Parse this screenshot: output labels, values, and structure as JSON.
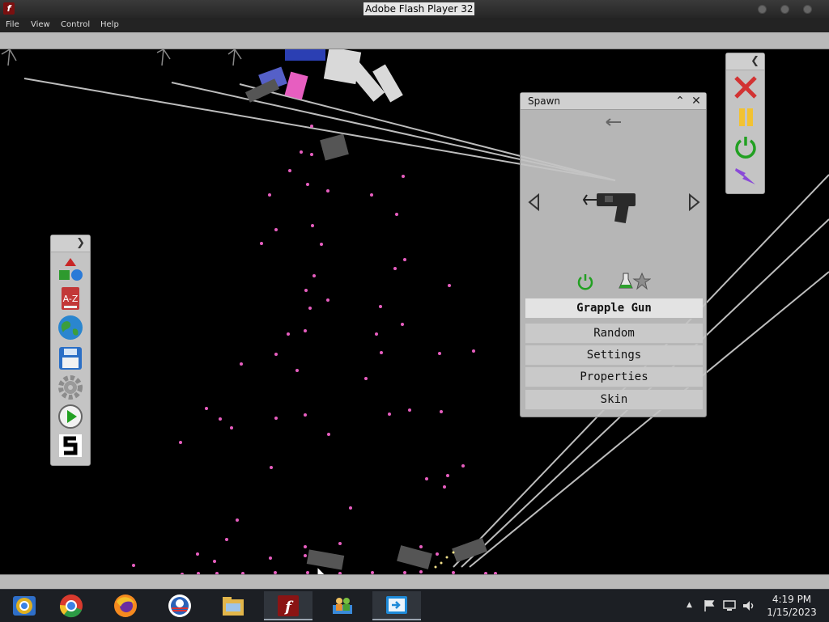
{
  "window": {
    "title": "Adobe Flash Player 32"
  },
  "menu": {
    "file": "File",
    "view": "View",
    "control": "Control",
    "help": "Help"
  },
  "spawn_panel": {
    "title": "Spawn",
    "options": [
      {
        "label": "Grapple Gun",
        "selected": true
      },
      {
        "label": "Random",
        "selected": false
      },
      {
        "label": "Settings",
        "selected": false
      },
      {
        "label": "Properties",
        "selected": false
      },
      {
        "label": "Skin",
        "selected": false
      }
    ]
  },
  "left_toolbar": {
    "icons": [
      "shapes-icon",
      "dictionary-a-z-icon",
      "globe-icon",
      "save-disk-icon",
      "settings-gear-icon",
      "play-icon",
      "s-logo-icon"
    ],
    "dictionary_text": "A-Z"
  },
  "right_toolbar": {
    "icons": [
      "close-x-icon",
      "pause-icon",
      "power-icon",
      "lightning-icon"
    ]
  },
  "taskbar": {
    "apps": [
      "chrome-icon",
      "chrome-icon",
      "firefox-icon",
      "edge-like-icon",
      "file-explorer-icon",
      "flash-player-icon",
      "network-people-icon",
      "remote-desktop-icon"
    ],
    "clock": {
      "time": "4:19 PM",
      "date": "1/15/2023"
    }
  },
  "colors": {
    "accent_pink": "#e75ec0",
    "panel_grey": "#c4c4c4",
    "taskbar": "#1c1f24"
  }
}
